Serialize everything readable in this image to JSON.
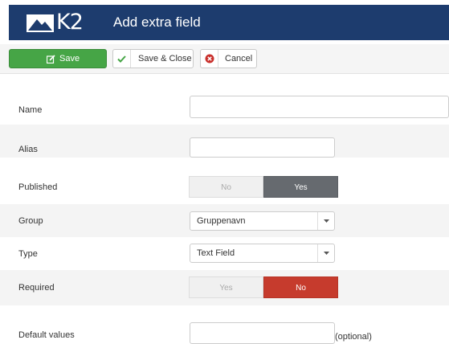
{
  "header": {
    "logo_text": "K2",
    "title": "Add extra field",
    "background": "#1d3c6e"
  },
  "toolbar": {
    "save_label": "Save",
    "save_close_label": "Save & Close",
    "cancel_label": "Cancel",
    "save_color": "#46a546",
    "cancel_icon_color": "#c9302c",
    "check_icon_color": "#46a546"
  },
  "form": {
    "name": {
      "label": "Name",
      "value": ""
    },
    "alias": {
      "label": "Alias",
      "value": ""
    },
    "published": {
      "label": "Published",
      "options": [
        "No",
        "Yes"
      ],
      "selected": "Yes"
    },
    "group": {
      "label": "Group",
      "selected": "Gruppenavn"
    },
    "type": {
      "label": "Type",
      "selected": "Text Field"
    },
    "required": {
      "label": "Required",
      "options": [
        "Yes",
        "No"
      ],
      "selected": "No",
      "selected_color": "#c63b2d"
    },
    "default_values": {
      "label": "Default values",
      "value": "",
      "hint": "(optional)"
    }
  }
}
